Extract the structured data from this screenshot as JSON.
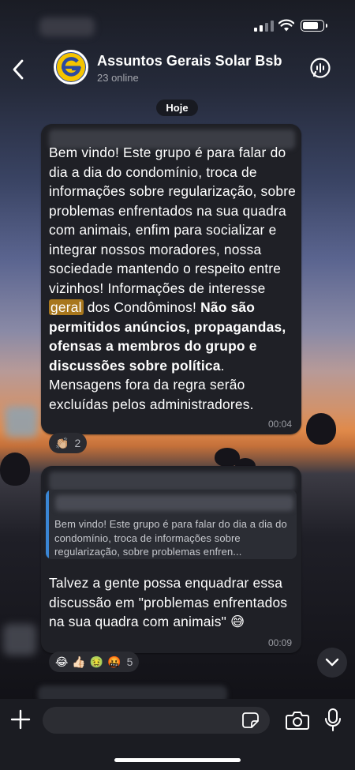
{
  "header": {
    "title": "Assuntos Gerais Solar Bsb",
    "subtitle": "23 online"
  },
  "date_pill": "Hoje",
  "messages": [
    {
      "text_before_highlight": "Bem vindo! Este grupo é para falar do dia a dia do condomínio, troca de informações sobre regularização, sobre problemas enfrentados na sua quadra com animais, enfim para socializar e integrar nossos moradores, nossa sociedade mantendo o respeito entre vizinhos! Informações de interesse ",
      "highlight": "geral",
      "text_after_highlight": " dos Condôminos! ",
      "bold_text": "Não são permitidos anúncios, propagandas, ofensas a membros do grupo e discussões sobre política",
      "text_end": ". Mensagens fora da regra serão excluídas pelos administradores.",
      "time": "00:04",
      "reactions": {
        "emojis": [
          "👏🏼"
        ],
        "count": "2"
      }
    },
    {
      "quoted_text": "Bem vindo! Este grupo é para falar do dia a dia do condomínio, troca de informações sobre regularização, sobre problemas enfren...",
      "text": "Talvez a gente possa enquadrar essa discussão em \"problemas enfrentados na sua quadra com animais\" 😅",
      "time": "00:09",
      "reactions": {
        "emojis": [
          "😂",
          "👍🏻",
          "🤢",
          "🤬"
        ],
        "count": "5"
      }
    }
  ],
  "icons": {
    "back": "chevron-left-icon",
    "call": "voice-chat-icon",
    "scroll": "chevron-down-icon",
    "attach": "plus-icon",
    "sticker": "sticker-icon",
    "camera": "camera-icon",
    "mic": "microphone-icon"
  },
  "colors": {
    "bubble": "#1f2026",
    "highlight": "#a8771d",
    "quote_bar": "#3a86d4",
    "avatar_yellow": "#f5c400"
  }
}
